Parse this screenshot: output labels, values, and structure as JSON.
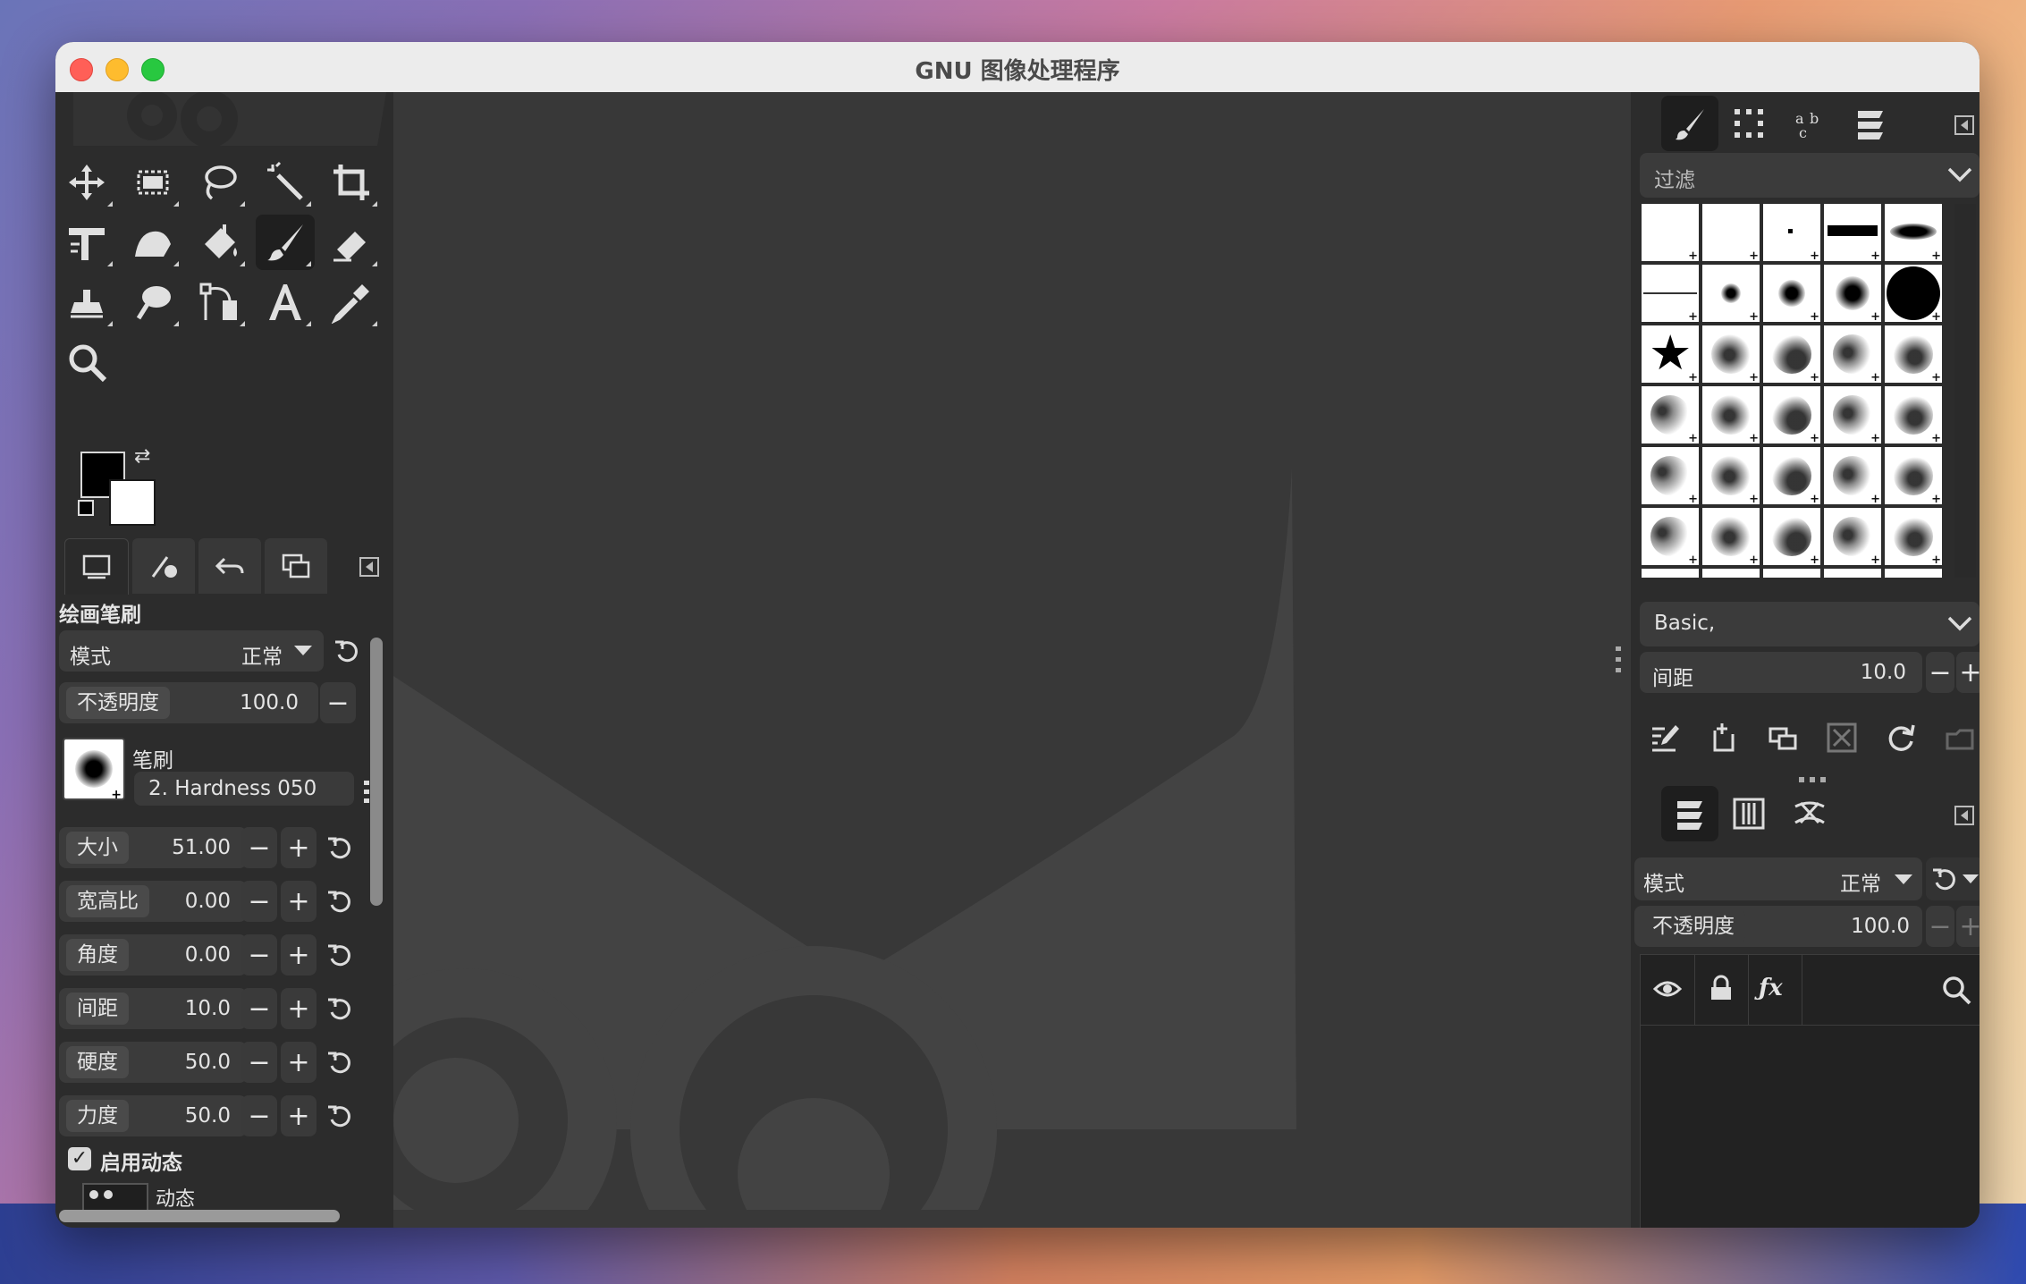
{
  "window": {
    "title": "GNU 图像处理程序"
  },
  "toolbox": {
    "tools": [
      {
        "name": "move-tool-icon"
      },
      {
        "name": "rect-select-icon"
      },
      {
        "name": "lasso-icon"
      },
      {
        "name": "fuzzy-select-icon"
      },
      {
        "name": "crop-icon"
      },
      {
        "name": "transform-icon"
      },
      {
        "name": "warp-icon"
      },
      {
        "name": "bucket-fill-icon"
      },
      {
        "name": "paintbrush-icon"
      },
      {
        "name": "eraser-icon"
      },
      {
        "name": "clone-icon"
      },
      {
        "name": "smudge-icon"
      },
      {
        "name": "paths-icon"
      },
      {
        "name": "text-icon"
      },
      {
        "name": "color-picker-icon"
      },
      {
        "name": "zoom-icon"
      }
    ],
    "active_tool": "paintbrush-icon",
    "fg_color": "#000000",
    "bg_color": "#ffffff"
  },
  "tool_options": {
    "title": "绘画笔刷",
    "mode_label": "模式",
    "mode_value": "正常",
    "opacity_label": "不透明度",
    "opacity_value": "100.0",
    "brush_label": "笔刷",
    "brush_name": "2. Hardness 050",
    "size_label": "大小",
    "size_value": "51.00",
    "aspect_label": "宽高比",
    "aspect_value": "0.00",
    "angle_label": "角度",
    "angle_value": "0.00",
    "spacing_label": "间距",
    "spacing_value": "10.0",
    "hardness_label": "硬度",
    "hardness_value": "50.0",
    "force_label": "力度",
    "force_value": "50.0",
    "dynamics_enable_label": "启用动态",
    "dynamics_label": "动态"
  },
  "brushes": {
    "filter_placeholder": "过滤",
    "tag_value": "Basic,",
    "spacing_label": "间距",
    "spacing_value": "10.0"
  },
  "layers": {
    "mode_label": "模式",
    "mode_value": "正常",
    "opacity_label": "不透明度",
    "opacity_value": "100.0"
  },
  "colors": {
    "accent": "#2c2c2c",
    "canvas": "#383838"
  }
}
